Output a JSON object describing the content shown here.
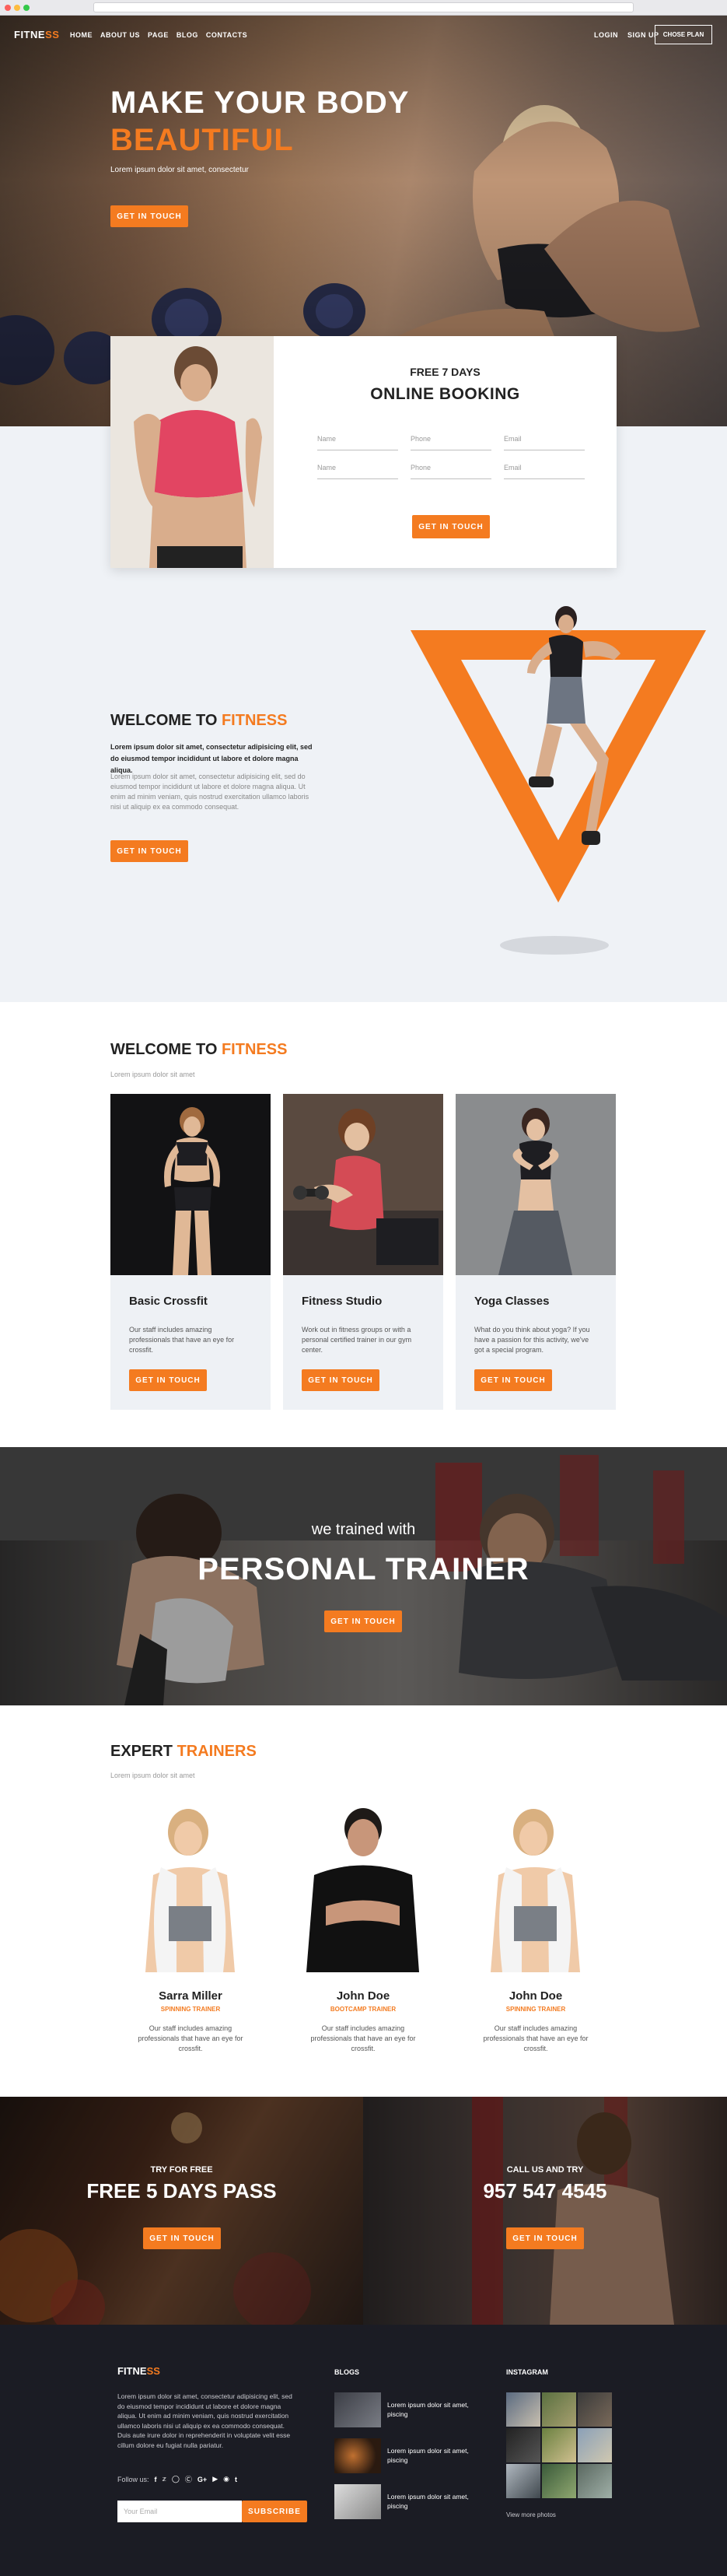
{
  "header": {
    "logo_main": "FITNE",
    "logo_accent": "SS",
    "nav": [
      "HOME",
      "ABOUT US",
      "PAGE",
      "BLOG",
      "CONTACTS"
    ],
    "login": "LOGIN",
    "signup": "SIGN UP",
    "choose_plan": "CHOSE PLAN"
  },
  "hero": {
    "title_line1": "MAKE YOUR BODY",
    "title_line2": "BEAUTIFUL",
    "subtitle": "Lorem ipsum dolor sit amet, consectetur",
    "button": "GET IN TOUCH"
  },
  "booking": {
    "pre_title": "FREE 7 DAYS",
    "title": "ONLINE BOOKING",
    "fields": [
      {
        "placeholder": "Name"
      },
      {
        "placeholder": "Phone"
      },
      {
        "placeholder": "Email"
      },
      {
        "placeholder": "Name"
      },
      {
        "placeholder": "Phone"
      },
      {
        "placeholder": "Email"
      }
    ],
    "button": "GET IN TOUCH"
  },
  "welcome1": {
    "title": "WELCOME TO ",
    "title_accent": "FITNESS",
    "bold_text": "Lorem ipsum dolor sit amet, consectetur adipisicing elit, sed do eiusmod tempor incididunt ut labore et dolore magna aliqua.",
    "text": "Lorem ipsum dolor sit amet, consectetur adipisicing elit, sed do eiusmod tempor incididunt ut labore et dolore magna aliqua. Ut enim ad minim veniam, quis nostrud exercitation ullamco laboris nisi ut aliquip ex ea commodo consequat.",
    "button": "GET IN TOUCH"
  },
  "welcome2": {
    "title": "WELCOME TO ",
    "title_accent": "FITNESS",
    "subtitle": "Lorem ipsum dolor sit amet",
    "services": [
      {
        "title": "Basic Crossfit",
        "text": "Our staff includes amazing professionals that have an eye for crossfit.",
        "button": "GET IN TOUCH"
      },
      {
        "title": "Fitness Studio",
        "text": "Work out in fitness groups or with a personal certified trainer in our gym center.",
        "button": "GET IN TOUCH"
      },
      {
        "title": "Yoga Classes",
        "text": "What do you think about yoga? If you have a passion for this activity, we've got a special program.",
        "button": "GET IN TOUCH"
      }
    ]
  },
  "personal_trainer": {
    "subtitle": "we trained with",
    "title": "PERSONAL TRAINER",
    "button": "GET IN TOUCH"
  },
  "trainers": {
    "title": "EXPERT ",
    "title_accent": "TRAINERS",
    "subtitle": "Lorem ipsum dolor sit amet",
    "items": [
      {
        "name": "Sarra Miller",
        "role": "SPINNING TRAINER",
        "desc": "Our staff includes amazing professionals that have an eye for crossfit."
      },
      {
        "name": "John Doe",
        "role": "BOOTCAMP TRAINER",
        "desc": "Our staff includes amazing professionals that have an eye for crossfit."
      },
      {
        "name": "John Doe",
        "role": "SPINNING TRAINER",
        "desc": "Our staff includes amazing professionals that have an eye for crossfit."
      }
    ]
  },
  "promos": [
    {
      "pre": "TRY FOR FREE",
      "title": "FREE 5 DAYS PASS",
      "button": "GET IN TOUCH"
    },
    {
      "pre": "CALL US AND TRY",
      "title": "957 547 4545",
      "button": "GET IN TOUCH"
    }
  ],
  "footer": {
    "logo_main": "FITNE",
    "logo_accent": "SS",
    "text": "Lorem ipsum dolor sit amet, consectetur adipisicing elit, sed do eiusmod tempor incididunt ut labore et dolore magna aliqua. Ut enim ad minim veniam, quis nostrud exercitation ullamco laboris nisi ut aliquip ex ea commodo consequat. Duis aute irure dolor in reprehenderit in voluptate velit esse cillum dolore eu fugiat nulla pariatur.",
    "follow_label": "Follow us:",
    "social_icons": [
      "f",
      "y",
      "in",
      "p",
      "G+",
      "yt",
      "dr",
      "t"
    ],
    "email_placeholder": "Your Email",
    "subscribe": "SUBSCRIBE",
    "blogs_heading": "BLOGS",
    "blogs": [
      {
        "text": "Lorem ipsum dolor sit amet, piscing"
      },
      {
        "text": "Lorem ipsum dolor sit amet, piscing"
      },
      {
        "text": "Lorem ipsum dolor sit amet, piscing"
      }
    ],
    "instagram_heading": "INSTAGRAM",
    "view_more": "View more photos"
  },
  "colors": {
    "accent": "#f47b20",
    "dark": "#1b1c24",
    "light_bg": "#eff2f6"
  }
}
